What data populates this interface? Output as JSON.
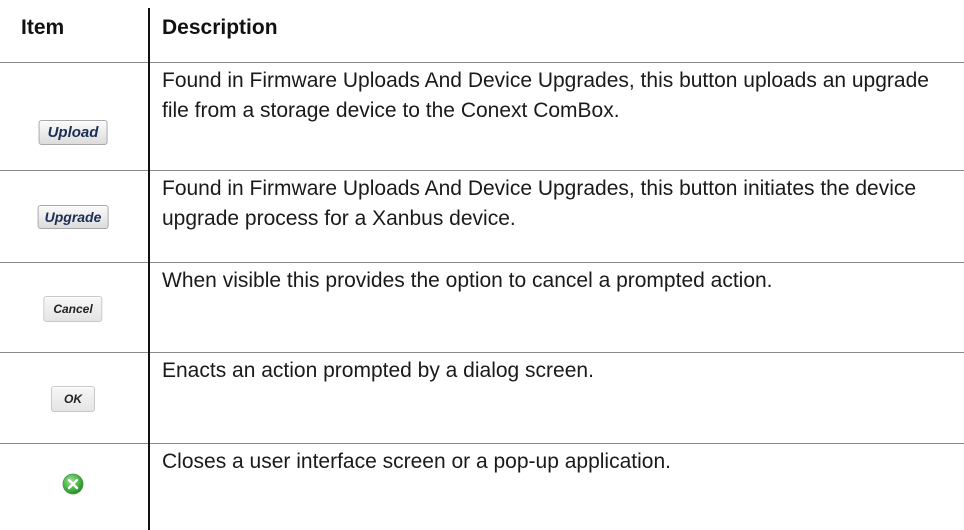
{
  "table": {
    "headers": {
      "item": "Item",
      "description": "Description"
    },
    "rows": [
      {
        "button_label": "Upload",
        "description": "Found in Firmware Uploads And Device Upgrades, this button uploads an upgrade file from a storage device to the Conext ComBox."
      },
      {
        "button_label": "Upgrade",
        "description": "Found in Firmware Uploads And Device Upgrades, this button initiates the device upgrade process for a Xanbus device."
      },
      {
        "button_label": "Cancel",
        "description": "When visible this provides the option to cancel a prompted action."
      },
      {
        "button_label": "OK",
        "description": "Enacts an action prompted by a dialog screen."
      },
      {
        "icon": "close-circle-green-icon",
        "description": "Closes a user interface screen or a pop-up application."
      }
    ]
  },
  "colors": {
    "text": "#111111",
    "rule": "#8a8a8a",
    "button_text": "#1b2f55",
    "close_icon": "#5cb85c"
  }
}
